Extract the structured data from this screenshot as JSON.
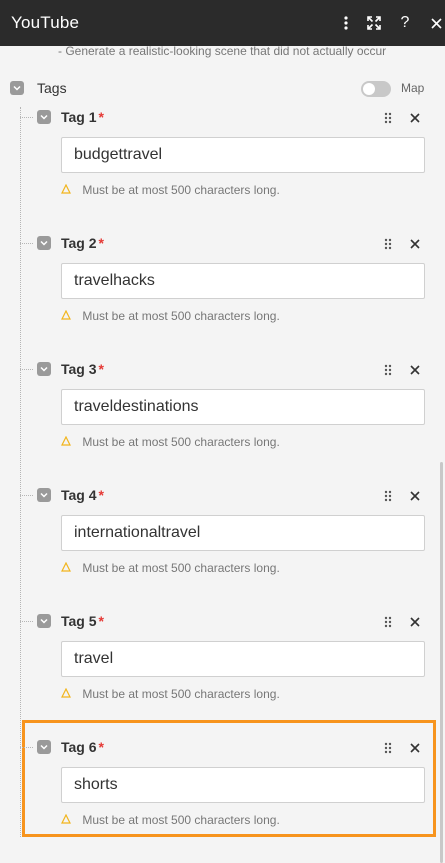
{
  "window": {
    "title": "YouTube",
    "menu_icon": "kebab-menu-icon",
    "expand_icon": "expand-icon",
    "help_label": "?",
    "close_icon": "close-icon"
  },
  "hint_text": "- Generate a realistic-looking scene that did not actually occur",
  "tags_section": {
    "label": "Tags",
    "map_label": "Map",
    "map_toggle_on": false
  },
  "tags": [
    {
      "label": "Tag 1",
      "required_mark": "*",
      "value": "budgettravel",
      "helper": "Must be at most 500 characters long."
    },
    {
      "label": "Tag 2",
      "required_mark": "*",
      "value": "travelhacks",
      "helper": "Must be at most 500 characters long."
    },
    {
      "label": "Tag 3",
      "required_mark": "*",
      "value": "traveldestinations",
      "helper": "Must be at most 500 characters long."
    },
    {
      "label": "Tag 4",
      "required_mark": "*",
      "value": "internationaltravel",
      "helper": "Must be at most 500 characters long."
    },
    {
      "label": "Tag 5",
      "required_mark": "*",
      "value": "travel",
      "helper": "Must be at most 500 characters long."
    },
    {
      "label": "Tag 6",
      "required_mark": "*",
      "value": "shorts",
      "helper": "Must be at most 500 characters long."
    }
  ],
  "colors": {
    "header_bg": "#2b2b2b",
    "highlight": "#f7941d",
    "required": "#e53935",
    "warning_icon": "#f2b51c"
  }
}
